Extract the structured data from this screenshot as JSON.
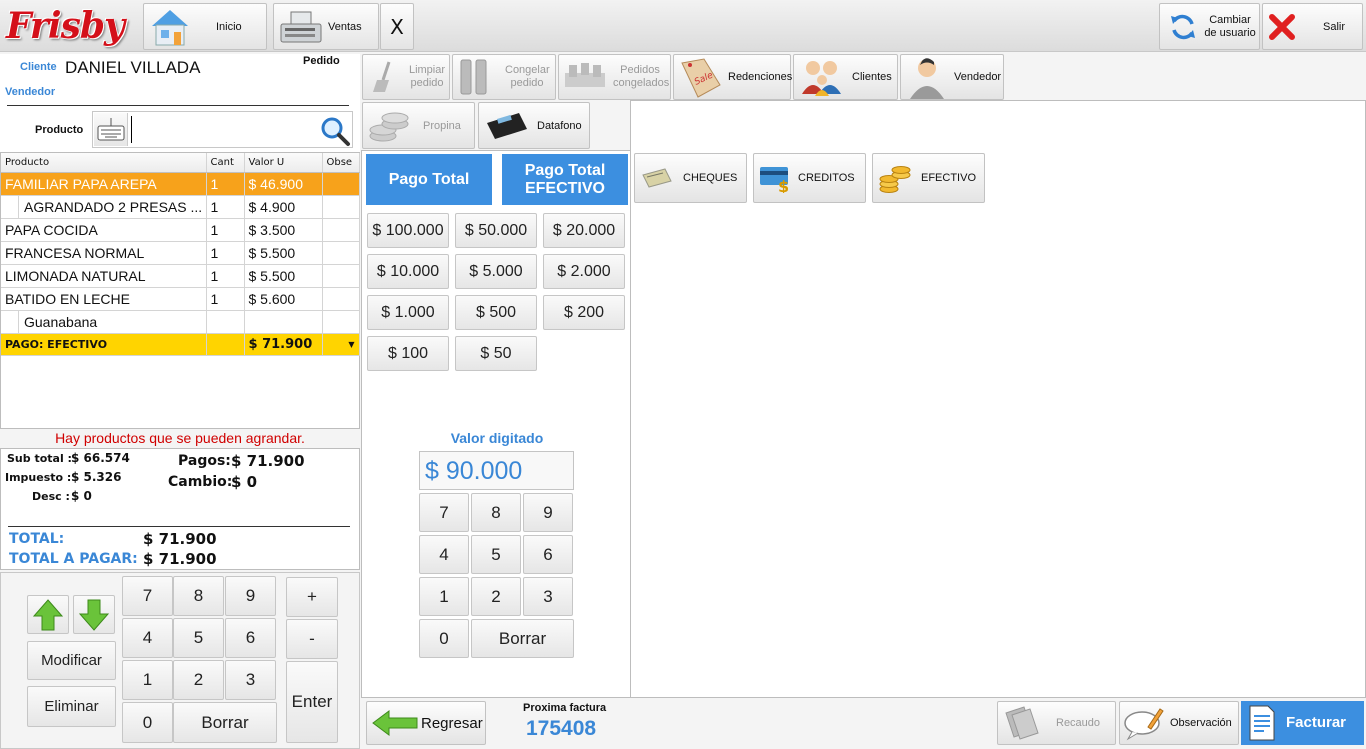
{
  "brand": {
    "logo": "Frisby"
  },
  "topbar": {
    "inicio": "Inicio",
    "ventas": "Ventas",
    "close": "X",
    "cambiar_usuario": "Cambiar de usuario",
    "salir": "Salir"
  },
  "header": {
    "cliente_label": "Cliente",
    "cliente_name": "DANIEL VILLADA",
    "pedido_label": "Pedido",
    "vendedor_label": "Vendedor",
    "producto_label": "Producto",
    "producto_value": ""
  },
  "toolbar": {
    "limpiar": "Limpiar pedido",
    "congelar": "Congelar pedido",
    "pedidos_congelados": "Pedidos congelados",
    "redenciones": "Redenciones",
    "clientes": "Clientes",
    "vendedor": "Vendedor",
    "propina": "Propina",
    "datafono": "Datafono"
  },
  "order_table": {
    "headers": [
      "Producto",
      "Cant",
      "Valor U",
      "Obse"
    ],
    "rows": [
      {
        "product": "FAMILIAR PAPA AREPA",
        "qty": "1",
        "price": "$ 46.900",
        "obs": "",
        "style": "selected"
      },
      {
        "product": "AGRANDADO 2 PRESAS ...",
        "qty": "1",
        "price": "$ 4.900",
        "obs": "",
        "style": "sub"
      },
      {
        "product": "PAPA COCIDA",
        "qty": "1",
        "price": "$ 3.500",
        "obs": "",
        "style": "normal"
      },
      {
        "product": "FRANCESA NORMAL",
        "qty": "1",
        "price": "$ 5.500",
        "obs": "",
        "style": "normal"
      },
      {
        "product": "LIMONADA NATURAL",
        "qty": "1",
        "price": "$ 5.500",
        "obs": "",
        "style": "normal"
      },
      {
        "product": "BATIDO EN LECHE",
        "qty": "1",
        "price": "$ 5.600",
        "obs": "",
        "style": "normal"
      },
      {
        "product": "Guanabana",
        "qty": "",
        "price": "",
        "obs": "",
        "style": "sub"
      }
    ],
    "payment_row": {
      "label": "PAGO: EFECTIVO",
      "price": "$ 71.900"
    }
  },
  "warning": "Hay productos que se pueden agrandar.",
  "totals": {
    "subtotal_label": "Sub total :",
    "subtotal": "$ 66.574",
    "impuesto_label": "Impuesto :",
    "impuesto": "$ 5.326",
    "desc_label": "Desc :",
    "desc": "$ 0",
    "pagos_label": "Pagos:",
    "pagos": "$ 71.900",
    "cambio_label": "Cambio:",
    "cambio": "$ 0",
    "total_label": "TOTAL:",
    "total": "$ 71.900",
    "total_pagar_label": "TOTAL A PAGAR:",
    "total_pagar": "$ 71.900"
  },
  "left_keypad": {
    "modificar": "Modificar",
    "eliminar": "Eliminar",
    "keys": [
      "7",
      "8",
      "9",
      "4",
      "5",
      "6",
      "1",
      "2",
      "3",
      "0"
    ],
    "borrar": "Borrar",
    "plus": "+",
    "minus": "-",
    "enter": "Enter"
  },
  "payment": {
    "pago_total": "Pago Total",
    "pago_total_efectivo": "Pago Total EFECTIVO",
    "amounts": [
      "$ 100.000",
      "$ 50.000",
      "$ 20.000",
      "$ 10.000",
      "$ 5.000",
      "$ 2.000",
      "$ 1.000",
      "$ 500",
      "$ 200",
      "$ 100",
      "$ 50"
    ],
    "valor_label": "Valor digitado",
    "valor": "$ 90.000",
    "keys": [
      "7",
      "8",
      "9",
      "4",
      "5",
      "6",
      "1",
      "2",
      "3",
      "0"
    ],
    "borrar": "Borrar"
  },
  "methods": {
    "cheques": "CHEQUES",
    "creditos": "CREDITOS",
    "efectivo": "EFECTIVO"
  },
  "footer": {
    "regresar": "Regresar",
    "proxima_label": "Proxima factura",
    "proxima": "175408",
    "recaudo": "Recaudo",
    "observacion": "Observación",
    "facturar": "Facturar"
  },
  "colors": {
    "selected_row": "#f7a21b",
    "payment_row": "#ffd400",
    "accent_blue": "#3c8fe0",
    "warning": "#d00000"
  }
}
